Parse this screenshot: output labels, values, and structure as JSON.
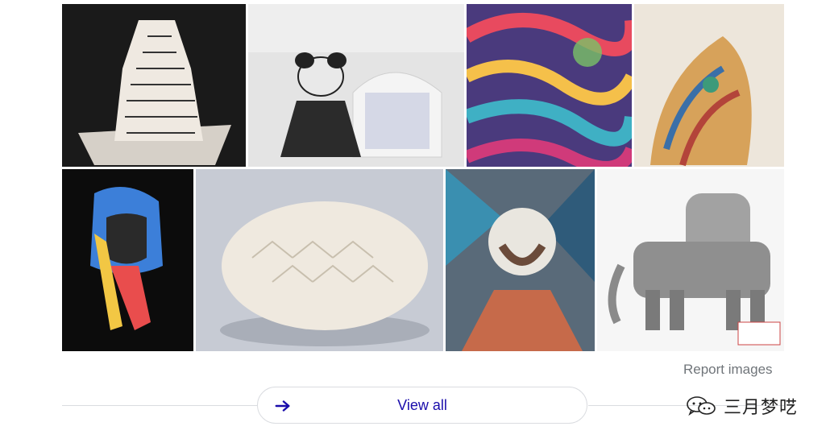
{
  "images": [
    {
      "name": "paper-sculpture-spiral-cone"
    },
    {
      "name": "paper-panda-store-display"
    },
    {
      "name": "quilling-colorful-swirls"
    },
    {
      "name": "quilling-face-portrait"
    },
    {
      "name": "paper-headscarf-portrait"
    },
    {
      "name": "folded-paper-sphere"
    },
    {
      "name": "paper-bird-collage-portrait"
    },
    {
      "name": "cardboard-elephant-model"
    }
  ],
  "footer": {
    "report_label": "Report images",
    "view_all_label": "View all"
  },
  "watermark": {
    "text": "三月梦呓"
  },
  "colors": {
    "link": "#1a0dab",
    "muted": "#70757a",
    "border": "#dadce0"
  }
}
